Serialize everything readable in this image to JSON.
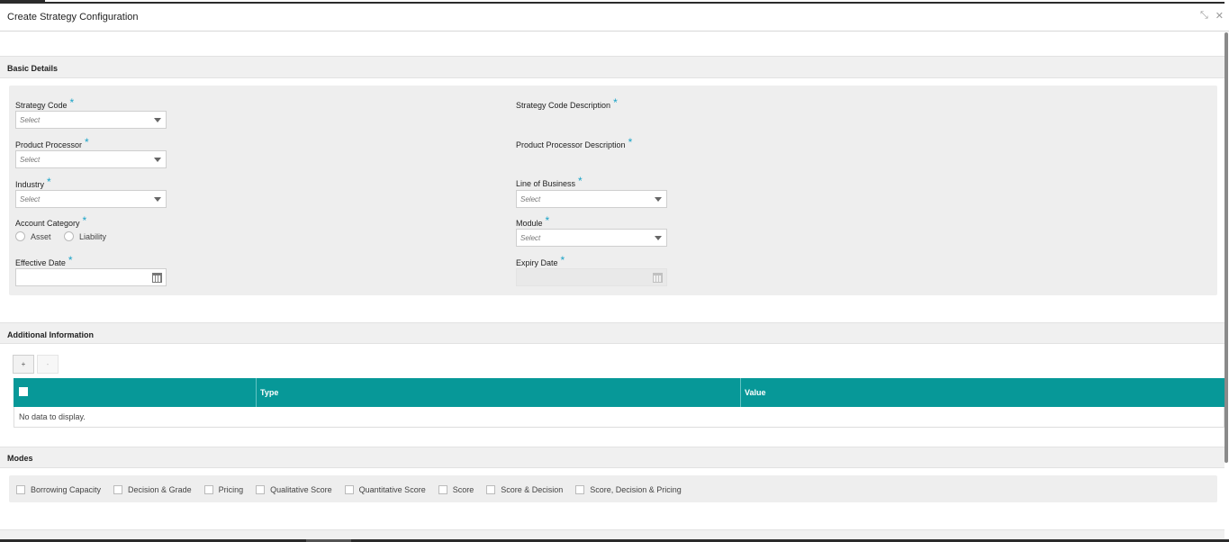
{
  "window": {
    "title": "Create Strategy Configuration",
    "icons": [
      "minimize-icon",
      "close-icon"
    ]
  },
  "sections": {
    "basic_details": "Basic Details",
    "additional_information": "Additional Information",
    "modes": "Modes"
  },
  "form": {
    "required_mark": "*",
    "strategy_code": {
      "label": "Strategy Code",
      "placeholder": "Select"
    },
    "strategy_code_description": {
      "label": "Strategy Code Description"
    },
    "product_processor": {
      "label": "Product Processor",
      "placeholder": "Select"
    },
    "product_processor_description": {
      "label": "Product Processor Description"
    },
    "industry": {
      "label": "Industry",
      "placeholder": "Select"
    },
    "line_of_business": {
      "label": "Line of Business",
      "placeholder": "Select"
    },
    "account_category": {
      "label": "Account Category",
      "options": [
        "Asset",
        "Liability"
      ]
    },
    "module": {
      "label": "Module",
      "placeholder": "Select"
    },
    "effective_date": {
      "label": "Effective Date"
    },
    "expiry_date": {
      "label": "Expiry Date"
    }
  },
  "additional_table": {
    "add_label": "+",
    "remove_label": "-",
    "columns": [
      "Type",
      "Value"
    ],
    "empty_text": "No data to display."
  },
  "modes": {
    "options": [
      "Borrowing Capacity",
      "Decision & Grade",
      "Pricing",
      "Qualitative Score",
      "Quantitative Score",
      "Score",
      "Score & Decision",
      "Score, Decision & Pricing"
    ]
  },
  "colors": {
    "table_header": "#079898",
    "required": "#1aa3c7"
  }
}
